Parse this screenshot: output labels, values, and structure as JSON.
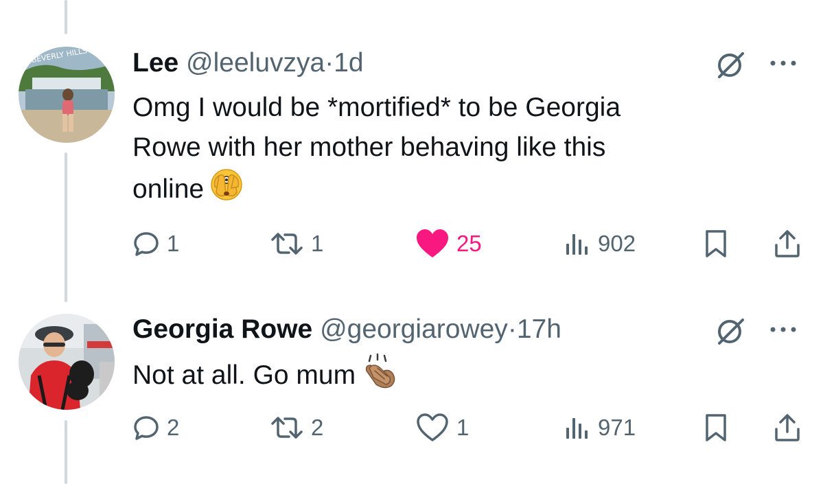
{
  "tweets": [
    {
      "name": "Lee",
      "handle": "@leeluvzya",
      "dot": "·",
      "time": "1d",
      "avatar_icon": "avatar-beverly-hills-photo",
      "avatar_text": "BEVERLY HILLS",
      "text_lines": [
        "Omg I would be *mortified* to be Georgia",
        "Rowe with her mother behaving like this",
        "online"
      ],
      "emoji": "face-with-open-eyes-and-hand-over-mouth-icon",
      "actions": {
        "replies": "1",
        "reposts": "1",
        "likes": "25",
        "views": "902"
      },
      "liked": true
    },
    {
      "name": "Georgia Rowe",
      "handle": "@georgiarowey",
      "dot": "·",
      "time": "17h",
      "avatar_icon": "avatar-woman-with-dog-photo",
      "text_lines": [
        "Not at all. Go mum"
      ],
      "emoji": "clapping-hands-icon",
      "actions": {
        "replies": "2",
        "reposts": "2",
        "likes": "1",
        "views": "971"
      },
      "liked": false
    }
  ],
  "colors": {
    "text": "#0f1419",
    "secondary": "#536471",
    "like": "#f91880",
    "thread": "#cfd9de"
  }
}
